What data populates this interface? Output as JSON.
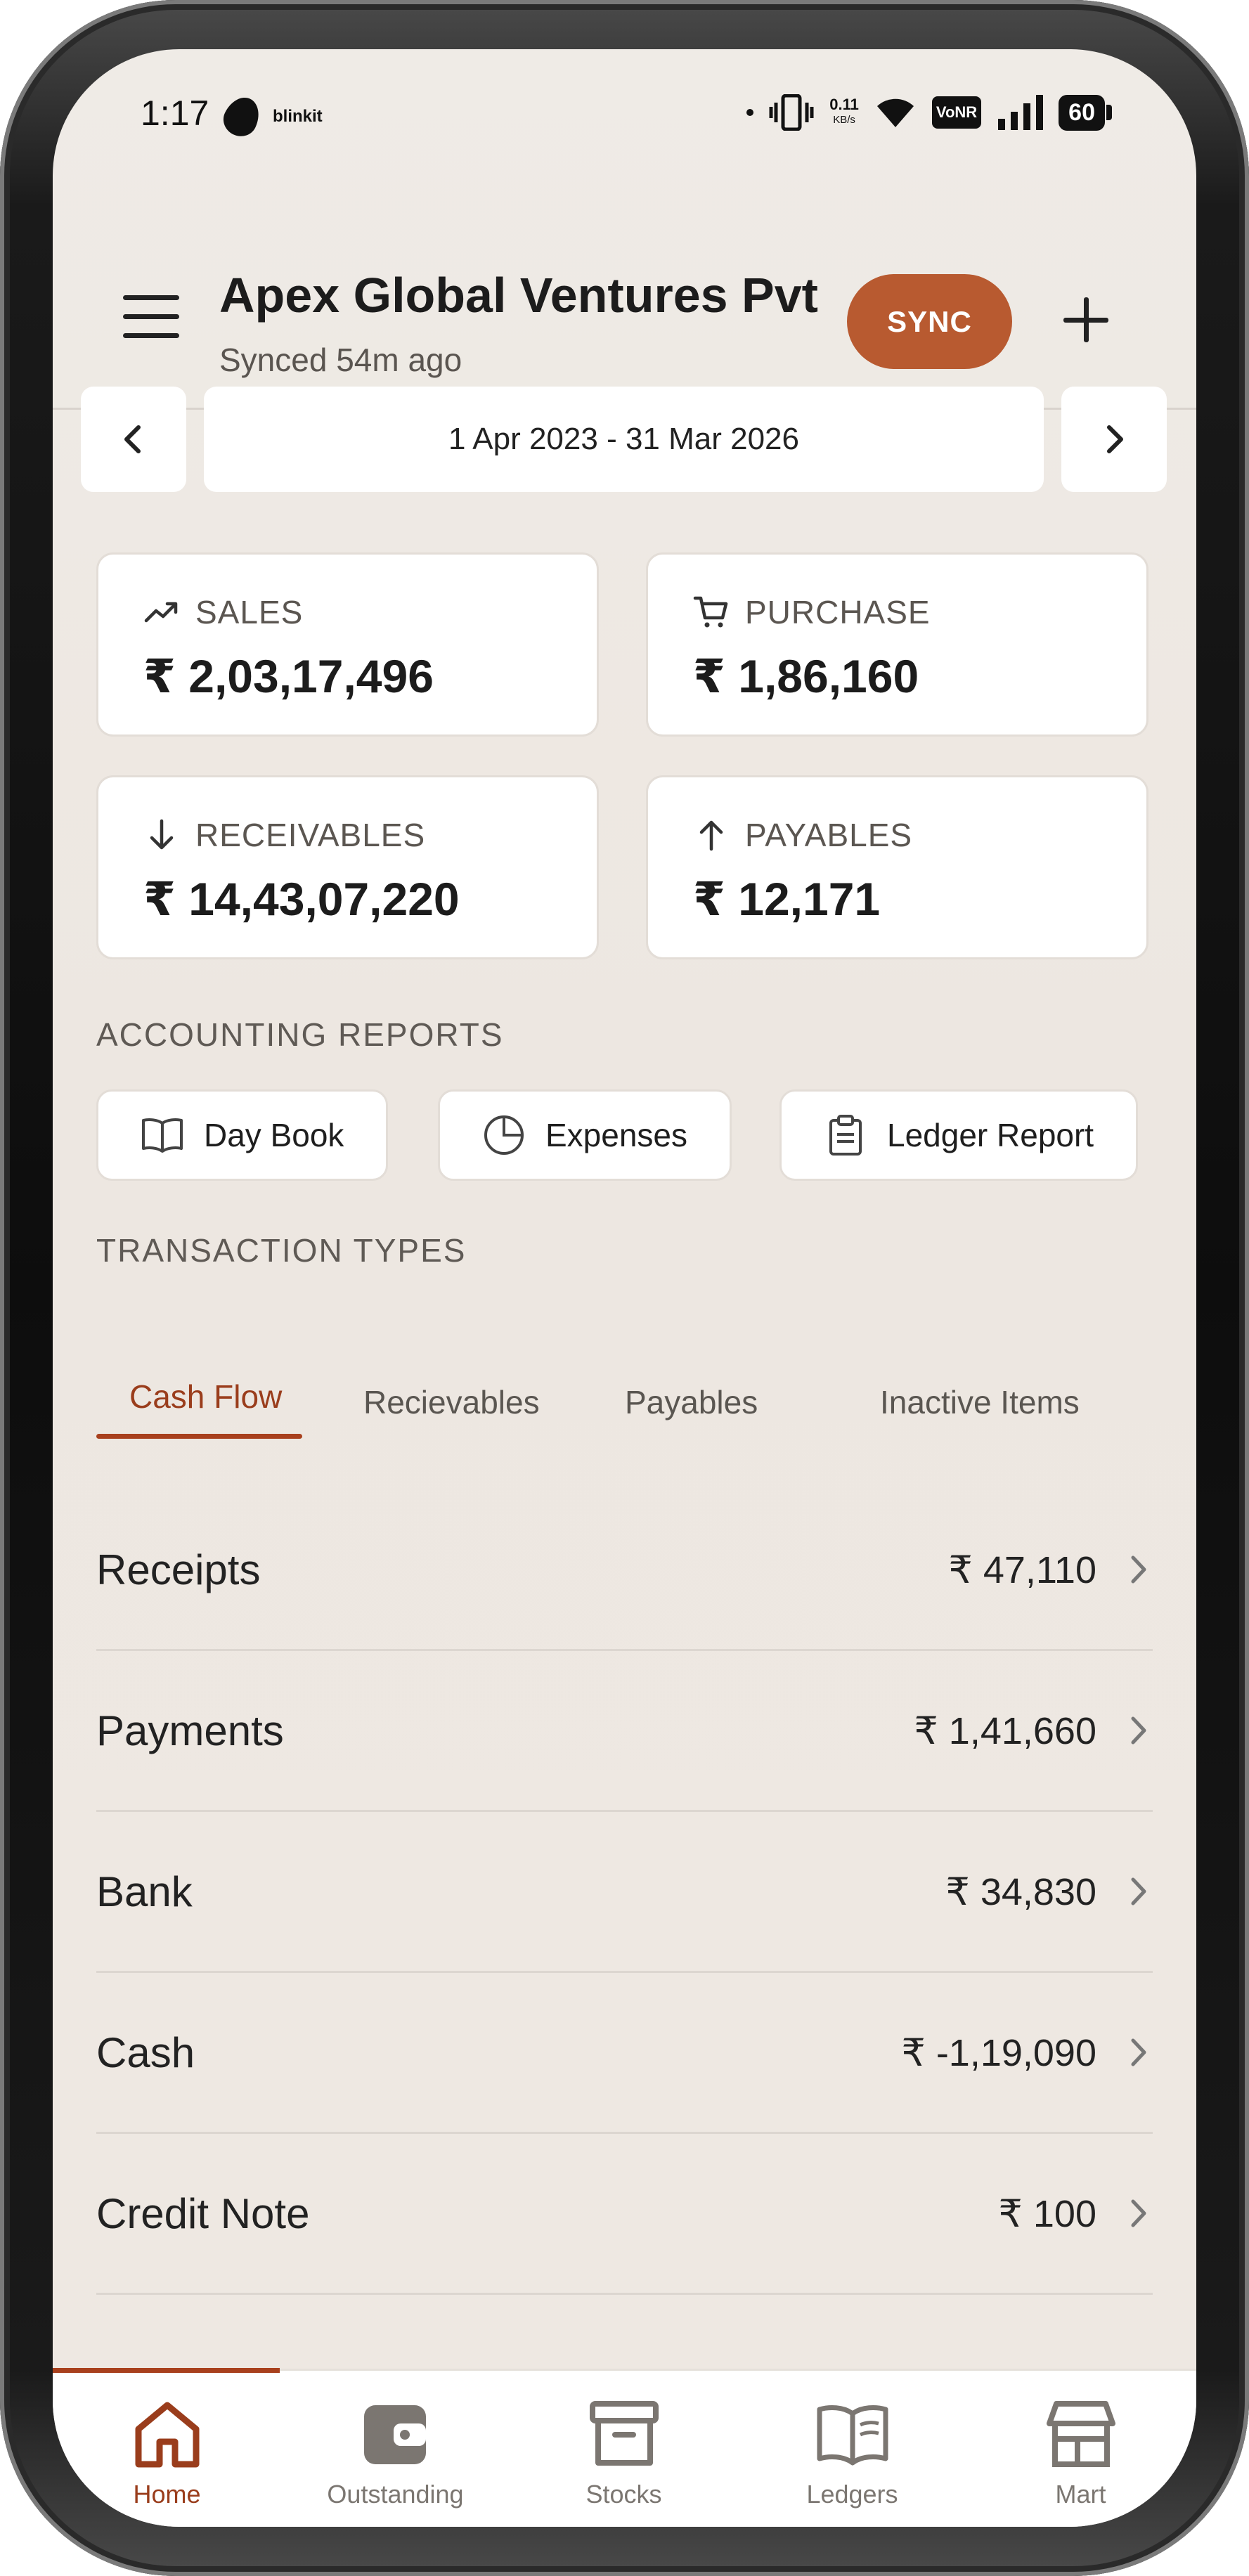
{
  "status_bar": {
    "time": "1:17",
    "app_brand": "blinkit",
    "speed_value": "0.11",
    "speed_unit": "KB/s",
    "network_tag": "VoNR",
    "battery": "60"
  },
  "header": {
    "title": "Apex Global Ventures Pvt",
    "subtitle": "Synced 54m ago",
    "sync_label": "SYNC",
    "menu_icon": "hamburger-menu-icon",
    "add_icon": "plus-icon"
  },
  "date_range": {
    "label": "1 Apr 2023 - 31 Mar 2026"
  },
  "stats": {
    "sales": {
      "label": "SALES",
      "value": "₹ 2,03,17,496",
      "icon": "trending-up-icon"
    },
    "purchase": {
      "label": "PURCHASE",
      "value": "₹ 1,86,160",
      "icon": "cart-icon"
    },
    "receivables": {
      "label": "RECEIVABLES",
      "value": "₹ 14,43,07,220",
      "icon": "arrow-down-icon"
    },
    "payables": {
      "label": "PAYABLES",
      "value": "₹ 12,171",
      "icon": "arrow-up-icon"
    }
  },
  "accounting_reports": {
    "heading": "ACCOUNTING REPORTS",
    "items": [
      {
        "label": "Day Book",
        "icon": "book-open-icon"
      },
      {
        "label": "Expenses",
        "icon": "pie-chart-icon"
      },
      {
        "label": "Ledger Report",
        "icon": "clipboard-icon"
      }
    ]
  },
  "transaction_types": {
    "heading": "TRANSACTION TYPES",
    "tabs": [
      {
        "label": "Cash Flow",
        "active": true
      },
      {
        "label": "Recievables",
        "active": false
      },
      {
        "label": "Payables",
        "active": false
      },
      {
        "label": "Inactive Items",
        "active": false
      }
    ]
  },
  "cash_flow_rows": [
    {
      "name": "Receipts",
      "amount": "₹ 47,110"
    },
    {
      "name": "Payments",
      "amount": "₹ 1,41,660"
    },
    {
      "name": "Bank",
      "amount": "₹ 34,830"
    },
    {
      "name": "Cash",
      "amount": "₹ -1,19,090"
    },
    {
      "name": "Credit Note",
      "amount": "₹ 100"
    }
  ],
  "bottom_nav": [
    {
      "label": "Home",
      "icon": "home-icon",
      "active": true
    },
    {
      "label": "Outstanding",
      "icon": "wallet-icon",
      "active": false
    },
    {
      "label": "Stocks",
      "icon": "archive-box-icon",
      "active": false
    },
    {
      "label": "Ledgers",
      "icon": "open-book-icon",
      "active": false
    },
    {
      "label": "Mart",
      "icon": "store-icon",
      "active": false
    }
  ],
  "colors": {
    "accent": "#b85a30",
    "active_tab": "#9a3d1c",
    "background": "#efebe6"
  }
}
